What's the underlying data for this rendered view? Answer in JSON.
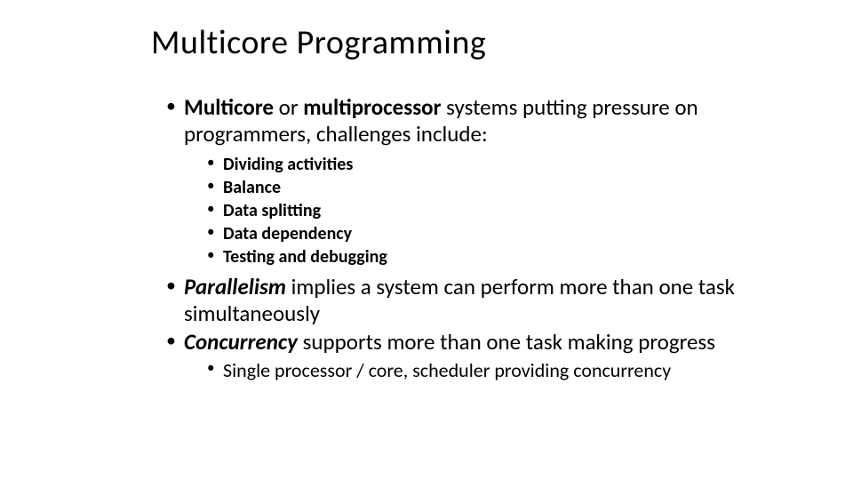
{
  "title": "Multicore Programming",
  "bullets": {
    "b1_pre": "Multicore",
    "b1_mid": " or ",
    "b1_bold2": "multiprocessor",
    "b1_post": " systems putting pressure on programmers, challenges include:",
    "sub": {
      "s1": "Dividing activities",
      "s2": "Balance",
      "s3": "Data splitting",
      "s4": "Data dependency",
      "s5": "Testing and debugging"
    },
    "b2_em": "Parallelism",
    "b2_post": " implies a system can perform more than one task simultaneously",
    "b3_em": "Concurrency",
    "b3_post": " supports more than one task making progress",
    "b3_sub": "Single processor / core, scheduler providing concurrency"
  }
}
